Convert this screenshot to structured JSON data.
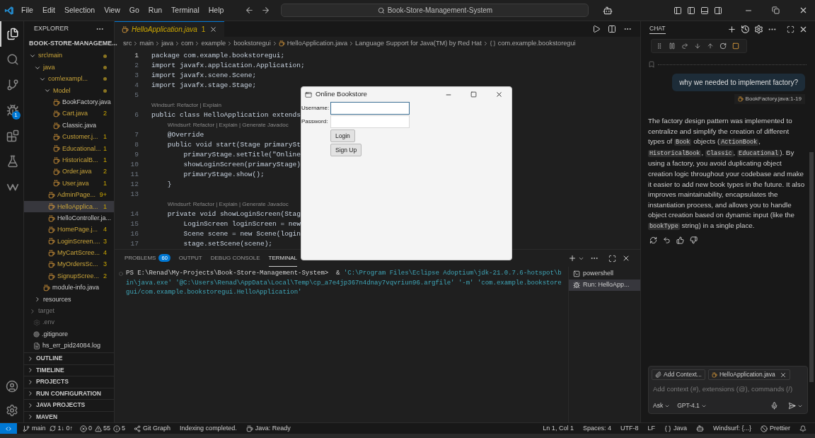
{
  "title_bar": {
    "menu": [
      "File",
      "Edit",
      "Selection",
      "View",
      "Go",
      "Run",
      "Terminal",
      "Help"
    ],
    "search": "Book-Store-Management-System"
  },
  "activity_bar": [
    {
      "kind": "files",
      "selected": true
    },
    {
      "kind": "search",
      "selected": false
    },
    {
      "kind": "source-control",
      "selected": false
    },
    {
      "kind": "run-debug",
      "selected": false,
      "badge": "1"
    },
    {
      "kind": "extensions",
      "selected": false
    },
    {
      "kind": "testing",
      "selected": false
    },
    {
      "kind": "windsurf",
      "selected": false
    }
  ],
  "explorer": {
    "title": "EXPLORER",
    "root": {
      "label": "BOOK-STORE-MANAGEME...",
      "expanded": true,
      "children": [
        {
          "label": "src\\main",
          "kind": "folder",
          "expanded": true,
          "modified": true,
          "ignored": false,
          "selected": false,
          "children": [
            {
              "label": "java",
              "kind": "folder",
              "expanded": true,
              "modified": true,
              "ignored": false,
              "selected": false,
              "children": [
                {
                  "label": "com\\exampl...",
                  "kind": "folder",
                  "expanded": true,
                  "modified": true,
                  "ignored": false,
                  "selected": false,
                  "children": [
                    {
                      "label": "Model",
                      "kind": "folder",
                      "expanded": true,
                      "modified": true,
                      "ignored": false,
                      "selected": false,
                      "children": [
                        {
                          "label": "BookFactory.java",
                          "kind": "java",
                          "warning": false,
                          "ignored": false,
                          "selected": false
                        },
                        {
                          "label": "Cart.java",
                          "kind": "java",
                          "warning": true,
                          "ignored": false,
                          "badge": "2",
                          "selected": false
                        },
                        {
                          "label": "Classic.java",
                          "kind": "java",
                          "warning": false,
                          "ignored": false,
                          "selected": false
                        },
                        {
                          "label": "Customer.j...",
                          "kind": "java",
                          "warning": true,
                          "ignored": false,
                          "badge": "1",
                          "selected": false
                        },
                        {
                          "label": "Educational...",
                          "kind": "java",
                          "warning": true,
                          "ignored": false,
                          "badge": "1",
                          "selected": false
                        },
                        {
                          "label": "HistoricalB...",
                          "kind": "java",
                          "warning": true,
                          "ignored": false,
                          "badge": "1",
                          "selected": false
                        },
                        {
                          "label": "Order.java",
                          "kind": "java",
                          "warning": true,
                          "ignored": false,
                          "badge": "2",
                          "selected": false
                        },
                        {
                          "label": "User.java",
                          "kind": "java",
                          "warning": true,
                          "ignored": false,
                          "badge": "1",
                          "selected": false
                        }
                      ]
                    },
                    {
                      "label": "AdminPage...",
                      "kind": "java",
                      "warning": true,
                      "ignored": false,
                      "badge": "9+",
                      "selected": false
                    },
                    {
                      "label": "HelloApplica...",
                      "kind": "java",
                      "warning": true,
                      "ignored": false,
                      "badge": "1",
                      "selected": true
                    },
                    {
                      "label": "HelloController.ja...",
                      "kind": "java",
                      "warning": false,
                      "ignored": false,
                      "selected": false
                    },
                    {
                      "label": "HomePage.j...",
                      "kind": "java",
                      "warning": true,
                      "ignored": false,
                      "badge": "4",
                      "selected": false
                    },
                    {
                      "label": "LoginScreen....",
                      "kind": "java",
                      "warning": true,
                      "ignored": false,
                      "badge": "3",
                      "selected": false
                    },
                    {
                      "label": "MyCartScree...",
                      "kind": "java",
                      "warning": true,
                      "ignored": false,
                      "badge": "4",
                      "selected": false
                    },
                    {
                      "label": "MyOrdersSc...",
                      "kind": "java",
                      "warning": true,
                      "ignored": false,
                      "badge": "3",
                      "selected": false
                    },
                    {
                      "label": "SignupScree...",
                      "kind": "java",
                      "warning": true,
                      "ignored": false,
                      "badge": "2",
                      "selected": false
                    }
                  ]
                },
                {
                  "label": "module-info.java",
                  "kind": "java",
                  "warning": false,
                  "ignored": false,
                  "selected": false
                }
              ]
            },
            {
              "label": "resources",
              "kind": "folder",
              "expanded": false,
              "modified": false,
              "ignored": false,
              "selected": false
            }
          ]
        },
        {
          "label": "target",
          "kind": "folder",
          "expanded": false,
          "modified": false,
          "ignored": true,
          "selected": false
        },
        {
          "label": ".env",
          "kind": "env",
          "warning": false,
          "ignored": true,
          "selected": false
        },
        {
          "label": ".gitignore",
          "kind": "git",
          "warning": false,
          "ignored": false,
          "selected": false
        },
        {
          "label": "hs_err_pid24084.log",
          "kind": "log",
          "warning": false,
          "ignored": false,
          "selected": false
        }
      ]
    },
    "sections": [
      "OUTLINE",
      "TIMELINE",
      "PROJECTS",
      "RUN CONFIGURATION",
      "JAVA PROJECTS",
      "MAVEN"
    ]
  },
  "editor": {
    "tabs": [
      {
        "label": "HelloApplication.java",
        "badge": "1",
        "selected": true
      }
    ],
    "breadcrumb": [
      {
        "text": "src",
        "kind": "folder"
      },
      {
        "text": "main",
        "kind": "folder"
      },
      {
        "text": "java",
        "kind": "folder"
      },
      {
        "text": "com",
        "kind": "folder"
      },
      {
        "text": "example",
        "kind": "folder"
      },
      {
        "text": "bookstoregui",
        "kind": "folder"
      },
      {
        "text": "HelloApplication.java",
        "kind": "java"
      },
      {
        "text": "Language Support for Java(TM) by Red Hat",
        "kind": "folder"
      },
      {
        "text": "com.example.bookstoregui",
        "kind": "namespace"
      }
    ],
    "lines": [
      {
        "kind": "line",
        "number": "1",
        "text": "package com.example.bookstoregui;"
      },
      {
        "kind": "line",
        "number": "2",
        "text": "import javafx.application.Application;"
      },
      {
        "kind": "line",
        "number": "3",
        "text": "import javafx.scene.Scene;"
      },
      {
        "kind": "line",
        "number": "4",
        "text": "import javafx.stage.Stage;"
      },
      {
        "kind": "line",
        "number": "5"
      },
      {
        "kind": "lens",
        "text": "Windsurf: Refactor | Explain"
      },
      {
        "kind": "line",
        "number": "6",
        "text": "public class HelloApplication extends"
      },
      {
        "kind": "lens",
        "text": "Windsurf: Refactor | Explain | Generate Javadoc"
      },
      {
        "kind": "line",
        "number": "7",
        "text": "    @Override"
      },
      {
        "kind": "line",
        "number": "8",
        "text": "    public void start(Stage primarySt"
      },
      {
        "kind": "line",
        "number": "9",
        "text": "        primaryStage.setTitle(\"Online"
      },
      {
        "kind": "line",
        "number": "10",
        "text": "        showLoginScreen(primaryStage)"
      },
      {
        "kind": "line",
        "number": "11",
        "text": "        primaryStage.show();"
      },
      {
        "kind": "line",
        "number": "12",
        "text": "    }"
      },
      {
        "kind": "line",
        "number": "13"
      },
      {
        "kind": "lens",
        "text": "Windsurf: Refactor | Explain | Generate Javadoc"
      },
      {
        "kind": "line",
        "number": "14",
        "text": "    private void showLoginScreen(Stag"
      },
      {
        "kind": "line",
        "number": "15",
        "text": "        LoginScreen loginScreen = new"
      },
      {
        "kind": "line",
        "number": "16",
        "text": "        Scene scene = new Scene(login"
      },
      {
        "kind": "line",
        "number": "17",
        "text": "        stage.setScene(scene);"
      }
    ]
  },
  "panel": {
    "tabs": [
      {
        "label": "PROBLEMS",
        "badge": "60",
        "selected": false
      },
      {
        "label": "OUTPUT",
        "selected": false
      },
      {
        "label": "DEBUG CONSOLE",
        "selected": false
      },
      {
        "label": "TERMINAL",
        "selected": true
      }
    ],
    "terminal_lines": [
      [
        {
          "text": "PS E:\\Renad\\My-Projects\\Book-Store-Management-System>  & ",
          "kind": "plain"
        },
        {
          "text": "'C:\\Program Files\\Eclipse Adoptium\\jdk-21.0.7.6-hotspot\\b",
          "kind": "string"
        }
      ],
      [
        {
          "text": "in\\java.exe' '@C:\\Users\\Renad\\AppData\\Local\\Temp\\cp_a7e4jp367n4dnay7vqvriun96.argfile' '-m' 'com.example.bookstore",
          "kind": "string"
        }
      ],
      [
        {
          "text": "gui/com.example.bookstoregui.HelloApplication'",
          "kind": "string"
        }
      ]
    ],
    "terminals": [
      {
        "label": "powershell",
        "kind": "shell",
        "selected": false
      },
      {
        "label": "Run: HelloApp...",
        "kind": "debug",
        "selected": true
      }
    ]
  },
  "chat": {
    "title": "CHAT",
    "user_message": "why we needed to implement factory?",
    "reference": "BookFactory.java:1-19",
    "answer": [
      {
        "text": "The factory design pattern was implemented to centralize and simplify the creation of different types of ",
        "code": false
      },
      {
        "text": "Book",
        "code": true
      },
      {
        "text": " objects (",
        "code": false
      },
      {
        "text": "ActionBook",
        "code": true
      },
      {
        "text": ", ",
        "code": false
      },
      {
        "text": "HistoricalBook",
        "code": true
      },
      {
        "text": ", ",
        "code": false
      },
      {
        "text": "Classic",
        "code": true
      },
      {
        "text": ", ",
        "code": false
      },
      {
        "text": "Educational",
        "code": true
      },
      {
        "text": "). By using a factory, you avoid duplicating object creation logic throughout your codebase and make it easier to add new book types in the future. It also improves maintainability, encapsulates the instantiation process, and allows you to handle object creation based on dynamic input (like the ",
        "code": false
      },
      {
        "text": "bookType",
        "code": true
      },
      {
        "text": " string) in a single place.",
        "code": false
      }
    ],
    "input": {
      "attach": "Add Context...",
      "file_chip": "HelloApplication.java",
      "placeholder": "Add context (#), extensions (@), commands (/)",
      "mode": "Ask",
      "model": "GPT-4.1"
    }
  },
  "dialog": {
    "title": "Online Bookstore",
    "fields": [
      {
        "label": "Username:",
        "focused": true
      },
      {
        "label": "Password:",
        "focused": false
      }
    ],
    "buttons": [
      "Login",
      "Sign Up"
    ]
  },
  "status_bar": {
    "branch": "main",
    "sync": "1↓ 0↑",
    "errors": "0",
    "warnings": "55",
    "infos": "5",
    "left": [
      {
        "text": "Git Graph",
        "kind": "graph"
      },
      {
        "text": "Indexing completed.",
        "kind": "plain"
      },
      {
        "text": "Java: Ready",
        "kind": "coffee"
      }
    ],
    "right": [
      {
        "text": "Ln 1, Col 1",
        "kind": "plain"
      },
      {
        "text": "Spaces: 4",
        "kind": "plain"
      },
      {
        "text": "UTF-8",
        "kind": "plain"
      },
      {
        "text": "LF",
        "kind": "plain"
      },
      {
        "text": "Java",
        "kind": "braces"
      },
      {
        "kind": "bot"
      },
      {
        "text": "Windsurf: {...}",
        "kind": "plain"
      },
      {
        "text": "Prettier",
        "kind": "ban"
      },
      {
        "kind": "bell"
      }
    ]
  }
}
